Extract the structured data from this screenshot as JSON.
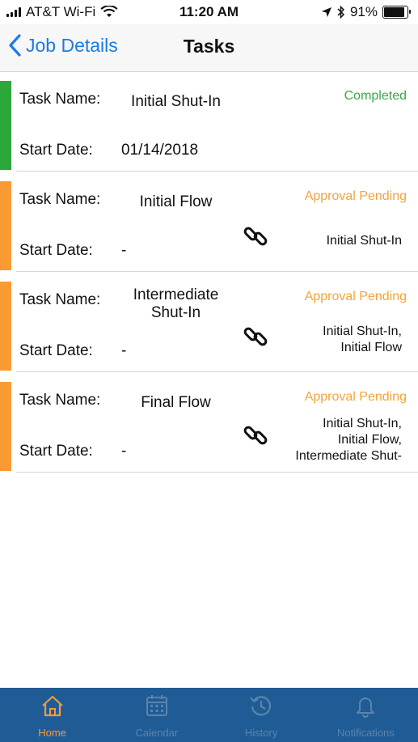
{
  "status_bar": {
    "carrier": "AT&T Wi-Fi",
    "time": "11:20 AM",
    "battery": "91%",
    "battery_level": 0.91
  },
  "nav": {
    "back_label": "Job Details",
    "title": "Tasks"
  },
  "labels": {
    "task_name": "Task Name:",
    "start_date": "Start Date:"
  },
  "tasks": [
    {
      "name_lines": [
        "Initial Shut-In"
      ],
      "start_date": "01/14/2018",
      "status": "Completed",
      "status_color": "#3aa84a",
      "stripe_color": "#2aa83a",
      "depends_on": []
    },
    {
      "name_lines": [
        "Initial Flow"
      ],
      "start_date": "-",
      "status": "Approval Pending",
      "status_color": "#f5a33a",
      "stripe_color": "#f99a33",
      "depends_on": [
        "Initial Shut-In"
      ]
    },
    {
      "name_lines": [
        "Intermediate",
        "Shut-In"
      ],
      "start_date": "-",
      "status": "Approval Pending",
      "status_color": "#f5a33a",
      "stripe_color": "#f99a33",
      "depends_on": [
        "Initial Shut-In,",
        "Initial Flow"
      ]
    },
    {
      "name_lines": [
        "Final Flow"
      ],
      "start_date": "-",
      "status": "Approval Pending",
      "status_color": "#f5a33a",
      "stripe_color": "#f99a33",
      "depends_on": [
        "Initial Shut-In,",
        "Initial Flow,",
        "Intermediate Shut-"
      ]
    }
  ],
  "tabs": [
    {
      "label": "Home",
      "icon": "home-icon",
      "active": true
    },
    {
      "label": "Calendar",
      "icon": "calendar-icon",
      "active": false
    },
    {
      "label": "History",
      "icon": "history-icon",
      "active": false
    },
    {
      "label": "Notifications",
      "icon": "bell-icon",
      "active": false
    }
  ],
  "colors": {
    "accent": "#1a7ce6",
    "tab_bar": "#1f5c96",
    "tab_active": "#f59a37",
    "tab_inactive": "#5c84ab"
  }
}
